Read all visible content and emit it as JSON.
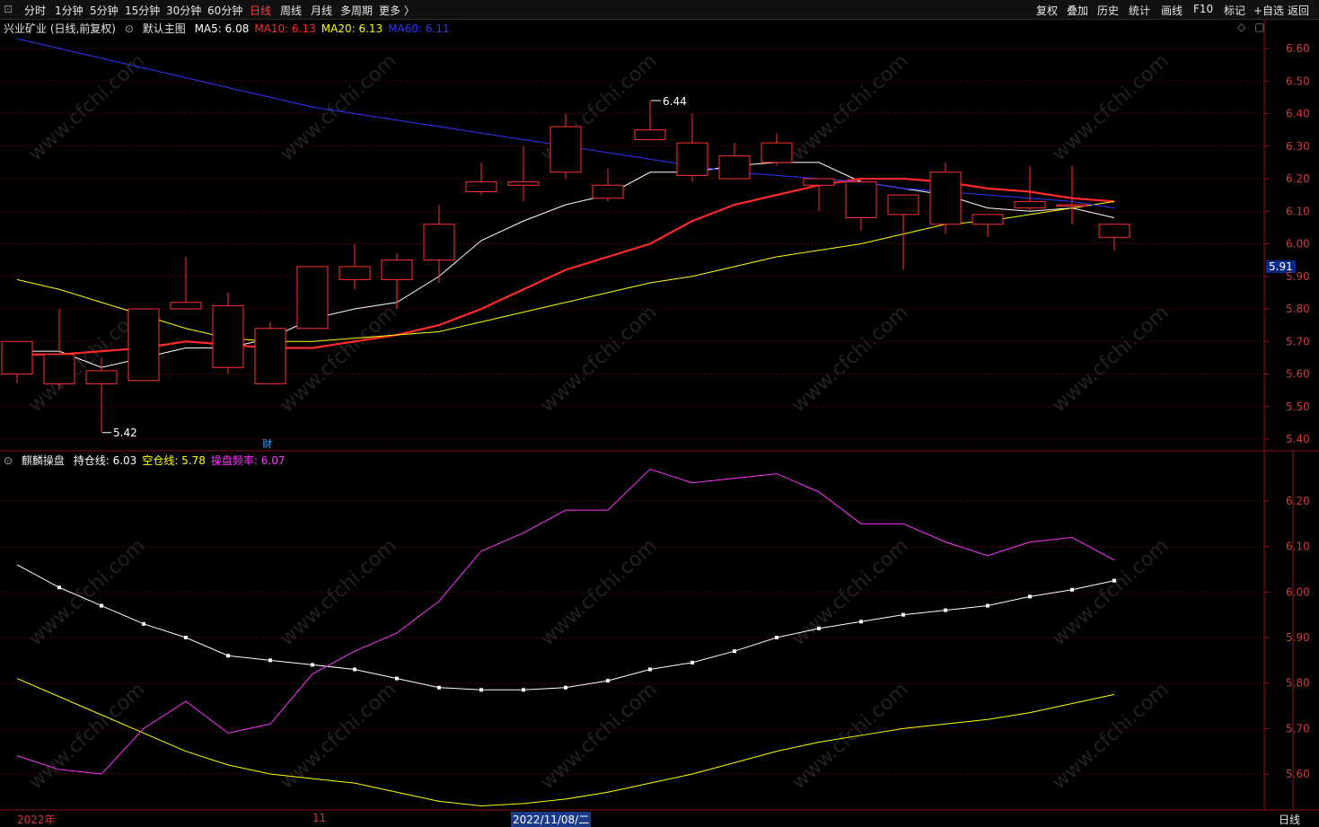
{
  "toolbar": {
    "left": [
      "分时",
      "1分钟",
      "5分钟",
      "15分钟",
      "30分钟",
      "60分钟",
      "日线",
      "周线",
      "月线",
      "多周期",
      "更多 〉"
    ],
    "active": "日线",
    "right": [
      "复权",
      "叠加",
      "历史",
      "统计",
      "画线",
      "F10",
      "标记",
      "+自选",
      "返回"
    ]
  },
  "main_panel": {
    "title": "兴业矿业 (日线,前复权)",
    "subtitle": "默认主图",
    "ma_labels": [
      {
        "text": "MA5: 6.08",
        "color": "#ffffff"
      },
      {
        "text": "MA10: 6.13",
        "color": "#ff2a2a"
      },
      {
        "text": "MA20: 6.13",
        "color": "#ffff00"
      },
      {
        "text": "MA60: 6.11",
        "color": "#3333ff"
      }
    ],
    "price_tag": "5.91",
    "annotations": {
      "high": "6.44",
      "low": "5.42",
      "fin": "财"
    }
  },
  "sub_panel": {
    "title": "麒麟操盘",
    "labels": [
      {
        "text": "持仓线: 6.03",
        "color": "#ffffff"
      },
      {
        "text": "空仓线: 5.78",
        "color": "#ffff00"
      },
      {
        "text": "操盘频率: 6.07",
        "color": "#ff33ff"
      }
    ]
  },
  "xaxis": {
    "labels": [
      "2022年",
      "11",
      "2022/11/08/二"
    ],
    "period": "日线"
  },
  "chart_data": [
    {
      "type": "candlestick",
      "title": "兴业矿业 (日线,前复权)",
      "ylim": [
        5.37,
        6.65
      ],
      "yticks": [
        6.6,
        6.5,
        6.4,
        6.3,
        6.2,
        6.1,
        6.0,
        5.9,
        5.8,
        5.7,
        5.6,
        5.5,
        5.4
      ],
      "candles": [
        {
          "o": 5.6,
          "c": 5.7,
          "h": 5.7,
          "l": 5.57
        },
        {
          "o": 5.57,
          "c": 5.66,
          "h": 5.8,
          "l": 5.55
        },
        {
          "o": 5.57,
          "c": 5.61,
          "h": 5.65,
          "l": 5.42
        },
        {
          "o": 5.58,
          "c": 5.8,
          "h": 5.8,
          "l": 5.58
        },
        {
          "o": 5.8,
          "c": 5.82,
          "h": 5.96,
          "l": 5.8
        },
        {
          "o": 5.62,
          "c": 5.81,
          "h": 5.85,
          "l": 5.6
        },
        {
          "o": 5.57,
          "c": 5.74,
          "h": 5.76,
          "l": 5.57
        },
        {
          "o": 5.74,
          "c": 5.93,
          "h": 5.93,
          "l": 5.74
        },
        {
          "o": 5.89,
          "c": 5.93,
          "h": 6.0,
          "l": 5.86
        },
        {
          "o": 5.89,
          "c": 5.95,
          "h": 5.97,
          "l": 5.8
        },
        {
          "o": 5.95,
          "c": 6.06,
          "h": 6.12,
          "l": 5.88
        },
        {
          "o": 6.16,
          "c": 6.19,
          "h": 6.25,
          "l": 6.15
        },
        {
          "o": 6.18,
          "c": 6.19,
          "h": 6.3,
          "l": 6.13
        },
        {
          "o": 6.22,
          "c": 6.36,
          "h": 6.4,
          "l": 6.2
        },
        {
          "o": 6.14,
          "c": 6.18,
          "h": 6.23,
          "l": 6.13
        },
        {
          "o": 6.32,
          "c": 6.35,
          "h": 6.44,
          "l": 6.32
        },
        {
          "o": 6.21,
          "c": 6.31,
          "h": 6.4,
          "l": 6.19
        },
        {
          "o": 6.2,
          "c": 6.27,
          "h": 6.31,
          "l": 6.2
        },
        {
          "o": 6.25,
          "c": 6.31,
          "h": 6.34,
          "l": 6.24
        },
        {
          "o": 6.18,
          "c": 6.2,
          "h": 6.2,
          "l": 6.1
        },
        {
          "o": 6.08,
          "c": 6.19,
          "h": 6.2,
          "l": 6.04
        },
        {
          "o": 6.09,
          "c": 6.15,
          "h": 6.15,
          "l": 5.92
        },
        {
          "o": 6.06,
          "c": 6.22,
          "h": 6.25,
          "l": 6.03
        },
        {
          "o": 6.06,
          "c": 6.09,
          "h": 6.09,
          "l": 6.02
        },
        {
          "o": 6.11,
          "c": 6.13,
          "h": 6.24,
          "l": 6.1
        },
        {
          "o": 6.12,
          "c": 6.12,
          "h": 6.24,
          "l": 6.06
        },
        {
          "o": 6.02,
          "c": 6.06,
          "h": 6.06,
          "l": 5.98
        }
      ],
      "series": [
        {
          "name": "MA5",
          "color": "#ffffff",
          "values": [
            5.67,
            5.67,
            5.62,
            5.65,
            5.68,
            5.68,
            5.71,
            5.77,
            5.8,
            5.82,
            5.9,
            6.01,
            6.07,
            6.12,
            6.15,
            6.22,
            6.22,
            6.24,
            6.25,
            6.25,
            6.19,
            6.17,
            6.15,
            6.11,
            6.1,
            6.11,
            6.08
          ]
        },
        {
          "name": "MA10",
          "color": "#ff2a2a",
          "values": [
            5.66,
            5.66,
            5.67,
            5.68,
            5.7,
            5.69,
            5.68,
            5.68,
            5.7,
            5.72,
            5.75,
            5.8,
            5.86,
            5.92,
            5.96,
            6.0,
            6.07,
            6.12,
            6.15,
            6.18,
            6.2,
            6.2,
            6.19,
            6.17,
            6.16,
            6.14,
            6.13
          ]
        },
        {
          "name": "MA20",
          "color": "#ffff00",
          "values": [
            5.89,
            5.86,
            5.82,
            5.78,
            5.74,
            5.71,
            5.7,
            5.7,
            5.71,
            5.72,
            5.73,
            5.76,
            5.79,
            5.82,
            5.85,
            5.88,
            5.9,
            5.93,
            5.96,
            5.98,
            6.0,
            6.03,
            6.06,
            6.07,
            6.09,
            6.11,
            6.13
          ]
        },
        {
          "name": "MA60",
          "color": "#3333ff",
          "values": [
            6.63,
            6.6,
            6.57,
            6.54,
            6.51,
            6.48,
            6.45,
            6.42,
            6.4,
            6.38,
            6.36,
            6.34,
            6.32,
            6.3,
            6.28,
            6.26,
            6.24,
            6.22,
            6.21,
            6.2,
            6.19,
            6.17,
            6.16,
            6.15,
            6.14,
            6.13,
            6.11
          ]
        }
      ]
    },
    {
      "type": "line",
      "title": "麒麟操盘",
      "ylim": [
        5.55,
        6.3
      ],
      "yticks": [
        6.2,
        6.1,
        6.0,
        5.9,
        5.8,
        5.7,
        5.6
      ],
      "series": [
        {
          "name": "持仓线",
          "color": "#ffffff",
          "values": [
            6.06,
            6.01,
            5.97,
            5.93,
            5.9,
            5.86,
            5.85,
            5.84,
            5.83,
            5.81,
            5.79,
            5.785,
            5.785,
            5.79,
            5.805,
            5.83,
            5.845,
            5.87,
            5.9,
            5.92,
            5.935,
            5.95,
            5.96,
            5.97,
            5.99,
            6.005,
            6.025
          ]
        },
        {
          "name": "空仓线",
          "color": "#ffff00",
          "values": [
            5.81,
            5.77,
            5.73,
            5.69,
            5.65,
            5.62,
            5.6,
            5.59,
            5.58,
            5.56,
            5.54,
            5.53,
            5.535,
            5.545,
            5.56,
            5.58,
            5.6,
            5.625,
            5.65,
            5.67,
            5.685,
            5.7,
            5.71,
            5.72,
            5.735,
            5.755,
            5.775
          ]
        },
        {
          "name": "操盘频率",
          "color": "#ff33ff",
          "values": [
            5.64,
            5.61,
            5.6,
            5.7,
            5.76,
            5.69,
            5.71,
            5.82,
            5.87,
            5.91,
            5.98,
            6.09,
            6.13,
            6.18,
            6.18,
            6.27,
            6.24,
            6.25,
            6.26,
            6.22,
            6.15,
            6.15,
            6.11,
            6.08,
            6.11,
            6.12,
            6.07
          ]
        }
      ]
    }
  ]
}
